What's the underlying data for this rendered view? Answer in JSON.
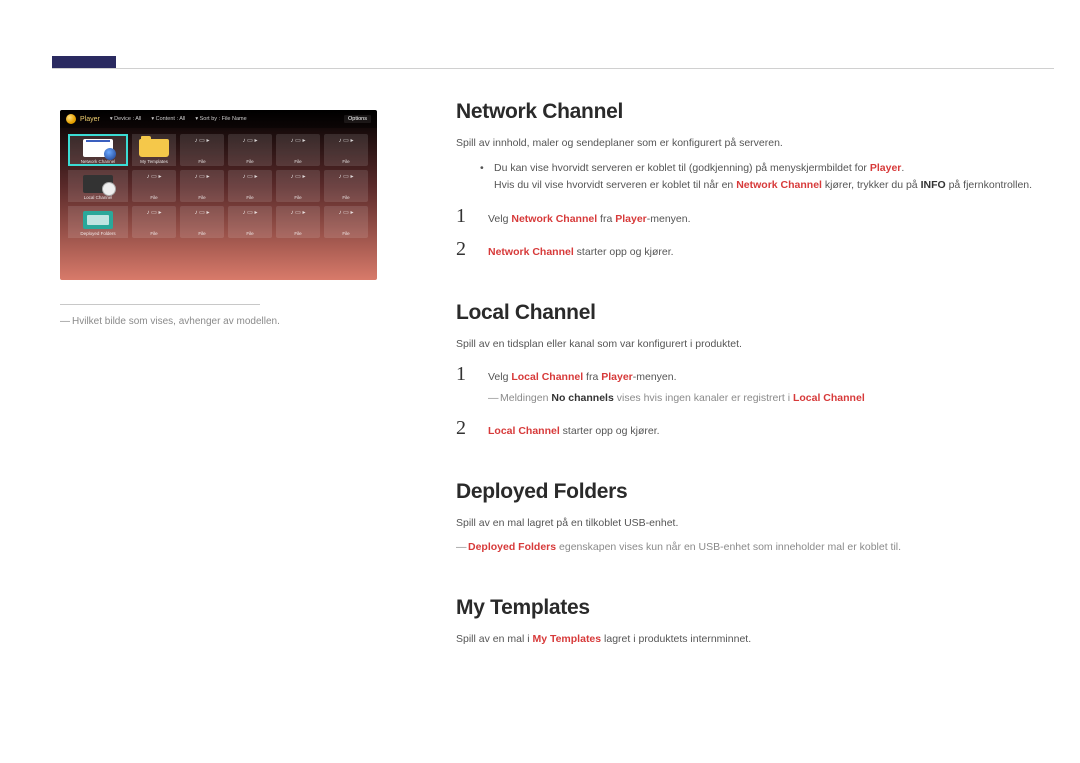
{
  "player_shot": {
    "title": "Player",
    "device_label": "Device : All",
    "content_label": "Content : All",
    "sort_label": "Sort by : File Name",
    "options_label": "Options",
    "left_items": [
      "Network Channel",
      "My Templates",
      "Local Channel",
      "Deployed Folders"
    ],
    "file_label": "File"
  },
  "footnote_left": "Hvilket bilde som vises, avhenger av modellen.",
  "network": {
    "heading": "Network Channel",
    "intro": "Spill av innhold, maler og sendeplaner som er konfigurert på serveren.",
    "bullet_pre": "Du kan vise hvorvidt serveren er koblet til (godkjenning) på menyskjermbildet for ",
    "bullet_player": "Player",
    "bullet_period": ".",
    "bullet2_pre": "Hvis du vil vise hvorvidt serveren er koblet til når en ",
    "bullet2_nc": "Network Channel",
    "bullet2_mid": " kjører, trykker du på ",
    "bullet2_info": "INFO",
    "bullet2_post": " på fjernkontrollen.",
    "step1_pre": "Velg ",
    "step1_nc": "Network Channel",
    "step1_mid": " fra ",
    "step1_player": "Player",
    "step1_post": "-menyen.",
    "step2_nc": "Network Channel",
    "step2_post": " starter opp og kjører."
  },
  "local": {
    "heading": "Local Channel",
    "intro": "Spill av en tidsplan eller kanal som var konfigurert i produktet.",
    "step1_pre": "Velg ",
    "step1_lc": "Local Channel",
    "step1_mid": " fra ",
    "step1_player": "Player",
    "step1_post": "-menyen.",
    "note_pre": "Meldingen ",
    "note_bold": "No channels",
    "note_mid": " vises hvis ingen kanaler er registrert i ",
    "note_lc": "Local Channel",
    "step2_lc": "Local Channel",
    "step2_post": " starter opp og kjører."
  },
  "deployed": {
    "heading": "Deployed Folders",
    "intro": "Spill av en mal lagret på en tilkoblet USB-enhet.",
    "note_df": "Deployed Folders",
    "note_post": " egenskapen vises kun når en USB-enhet som inneholder mal er koblet til."
  },
  "templates": {
    "heading": "My Templates",
    "intro_pre": "Spill av en mal i ",
    "intro_mt": "My Templates",
    "intro_post": " lagret i produktets internminnet."
  }
}
